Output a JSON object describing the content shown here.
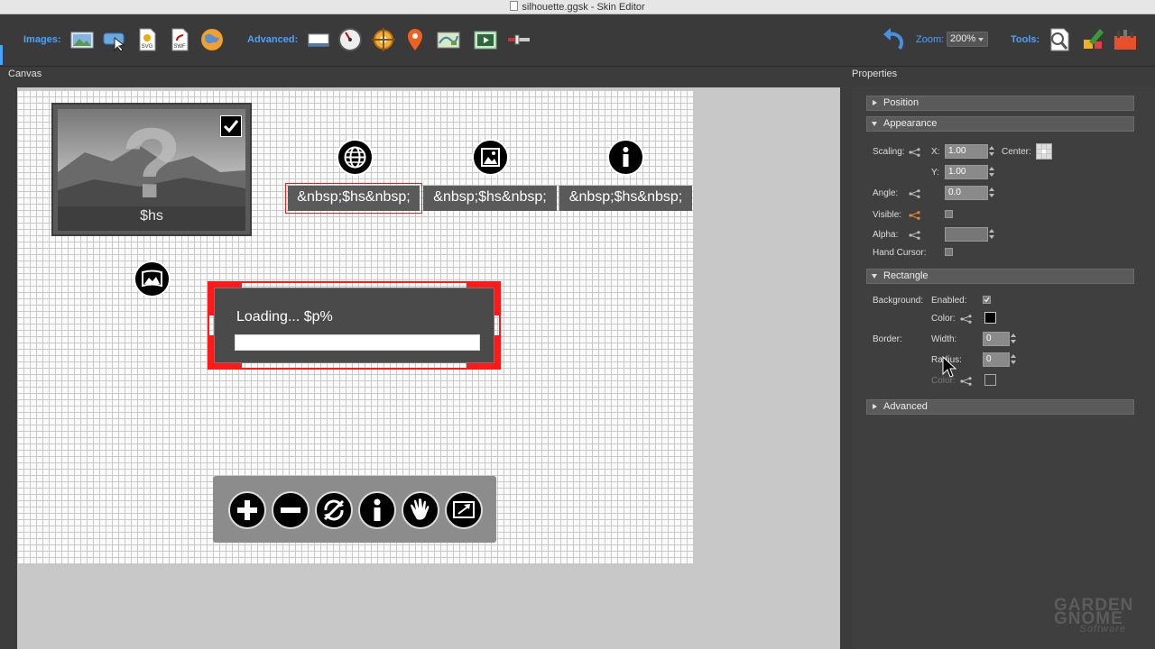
{
  "window": {
    "title": "silhouette.ggsk - Skin Editor"
  },
  "toolbar": {
    "images_label": "Images:",
    "advanced_label": "Advanced:",
    "zoom_label": "Zoom:",
    "zoom_value": "200%",
    "tools_label": "Tools:"
  },
  "panels": {
    "canvas_title": "Canvas",
    "properties_title": "Properties"
  },
  "canvas": {
    "thumb_label": "$hs",
    "text_boxes": [
      "&nbsp;$hs&nbsp;",
      "&nbsp;$hs&nbsp;",
      "&nbsp;$hs&nbsp;"
    ],
    "loading_text": "Loading... $p%",
    "loading_progress": 1.0
  },
  "properties": {
    "sections": {
      "position": "Position",
      "appearance": "Appearance",
      "rectangle": "Rectangle",
      "advanced": "Advanced"
    },
    "appearance": {
      "scaling_label": "Scaling:",
      "x_label": "X:",
      "x_value": "1.00",
      "y_label": "Y:",
      "y_value": "1.00",
      "center_label": "Center:",
      "angle_label": "Angle:",
      "angle_value": "0.0",
      "visible_label": "Visible:",
      "alpha_label": "Alpha:",
      "alpha_value": "",
      "hand_cursor_label": "Hand Cursor:"
    },
    "rectangle": {
      "background_label": "Background:",
      "enabled_label": "Enabled:",
      "color_label": "Color:",
      "border_label": "Border:",
      "width_label": "Width:",
      "width_value": "0",
      "radius_label": "Radius:",
      "radius_value": "0",
      "border_color_label": "Color:"
    }
  },
  "colors": {
    "accent": "#4aa3ff",
    "selection": "#ff1a1a",
    "visible_share": "#e6892e"
  },
  "watermark": {
    "line1": "GARDEN",
    "line2": "GNOME",
    "line3": "Software"
  }
}
